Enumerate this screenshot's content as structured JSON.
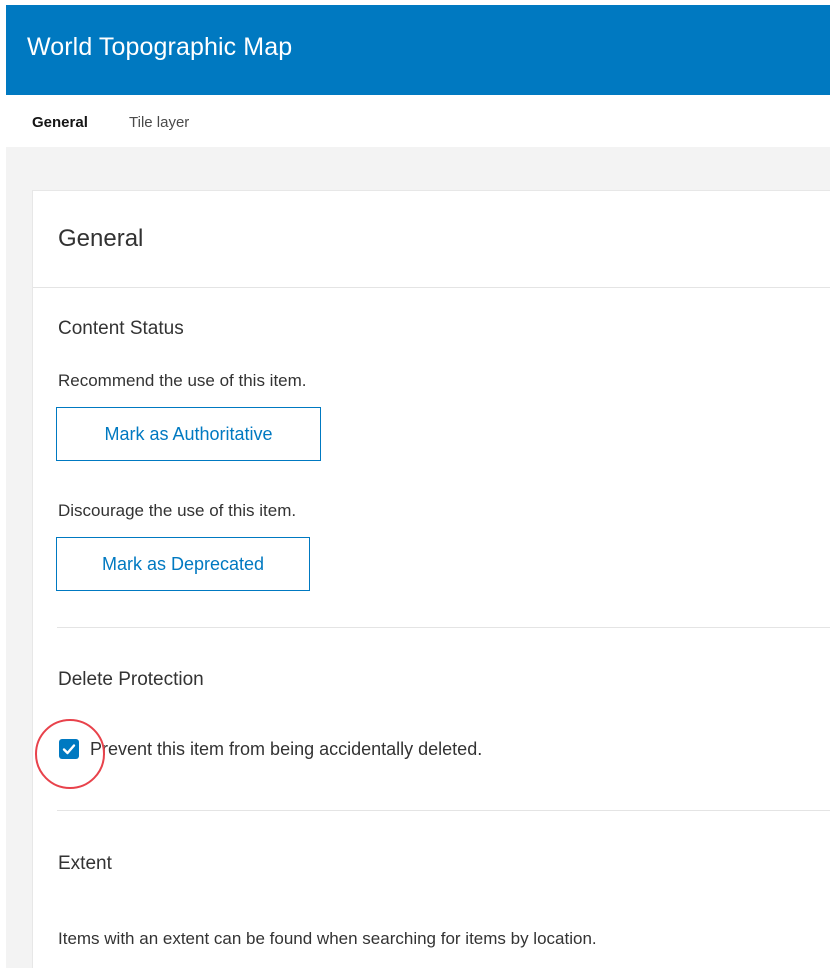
{
  "colors": {
    "brand": "#0079c1",
    "highlight": "#e8424b"
  },
  "header": {
    "title": "World Topographic Map"
  },
  "tabs": [
    {
      "label": "General",
      "active": true
    },
    {
      "label": "Tile layer",
      "active": false
    }
  ],
  "card": {
    "title": "General",
    "content_status": {
      "title": "Content Status",
      "recommend_text": "Recommend the use of this item.",
      "authoritative_button": "Mark as Authoritative",
      "discourage_text": "Discourage the use of this item.",
      "deprecated_button": "Mark as Deprecated"
    },
    "delete_protection": {
      "title": "Delete Protection",
      "checkbox_label": "Prevent this item from being accidentally deleted.",
      "checked": true,
      "check_icon": "checkmark-icon"
    },
    "extent": {
      "title": "Extent",
      "description": "Items with an extent can be found when searching for items by location."
    }
  }
}
